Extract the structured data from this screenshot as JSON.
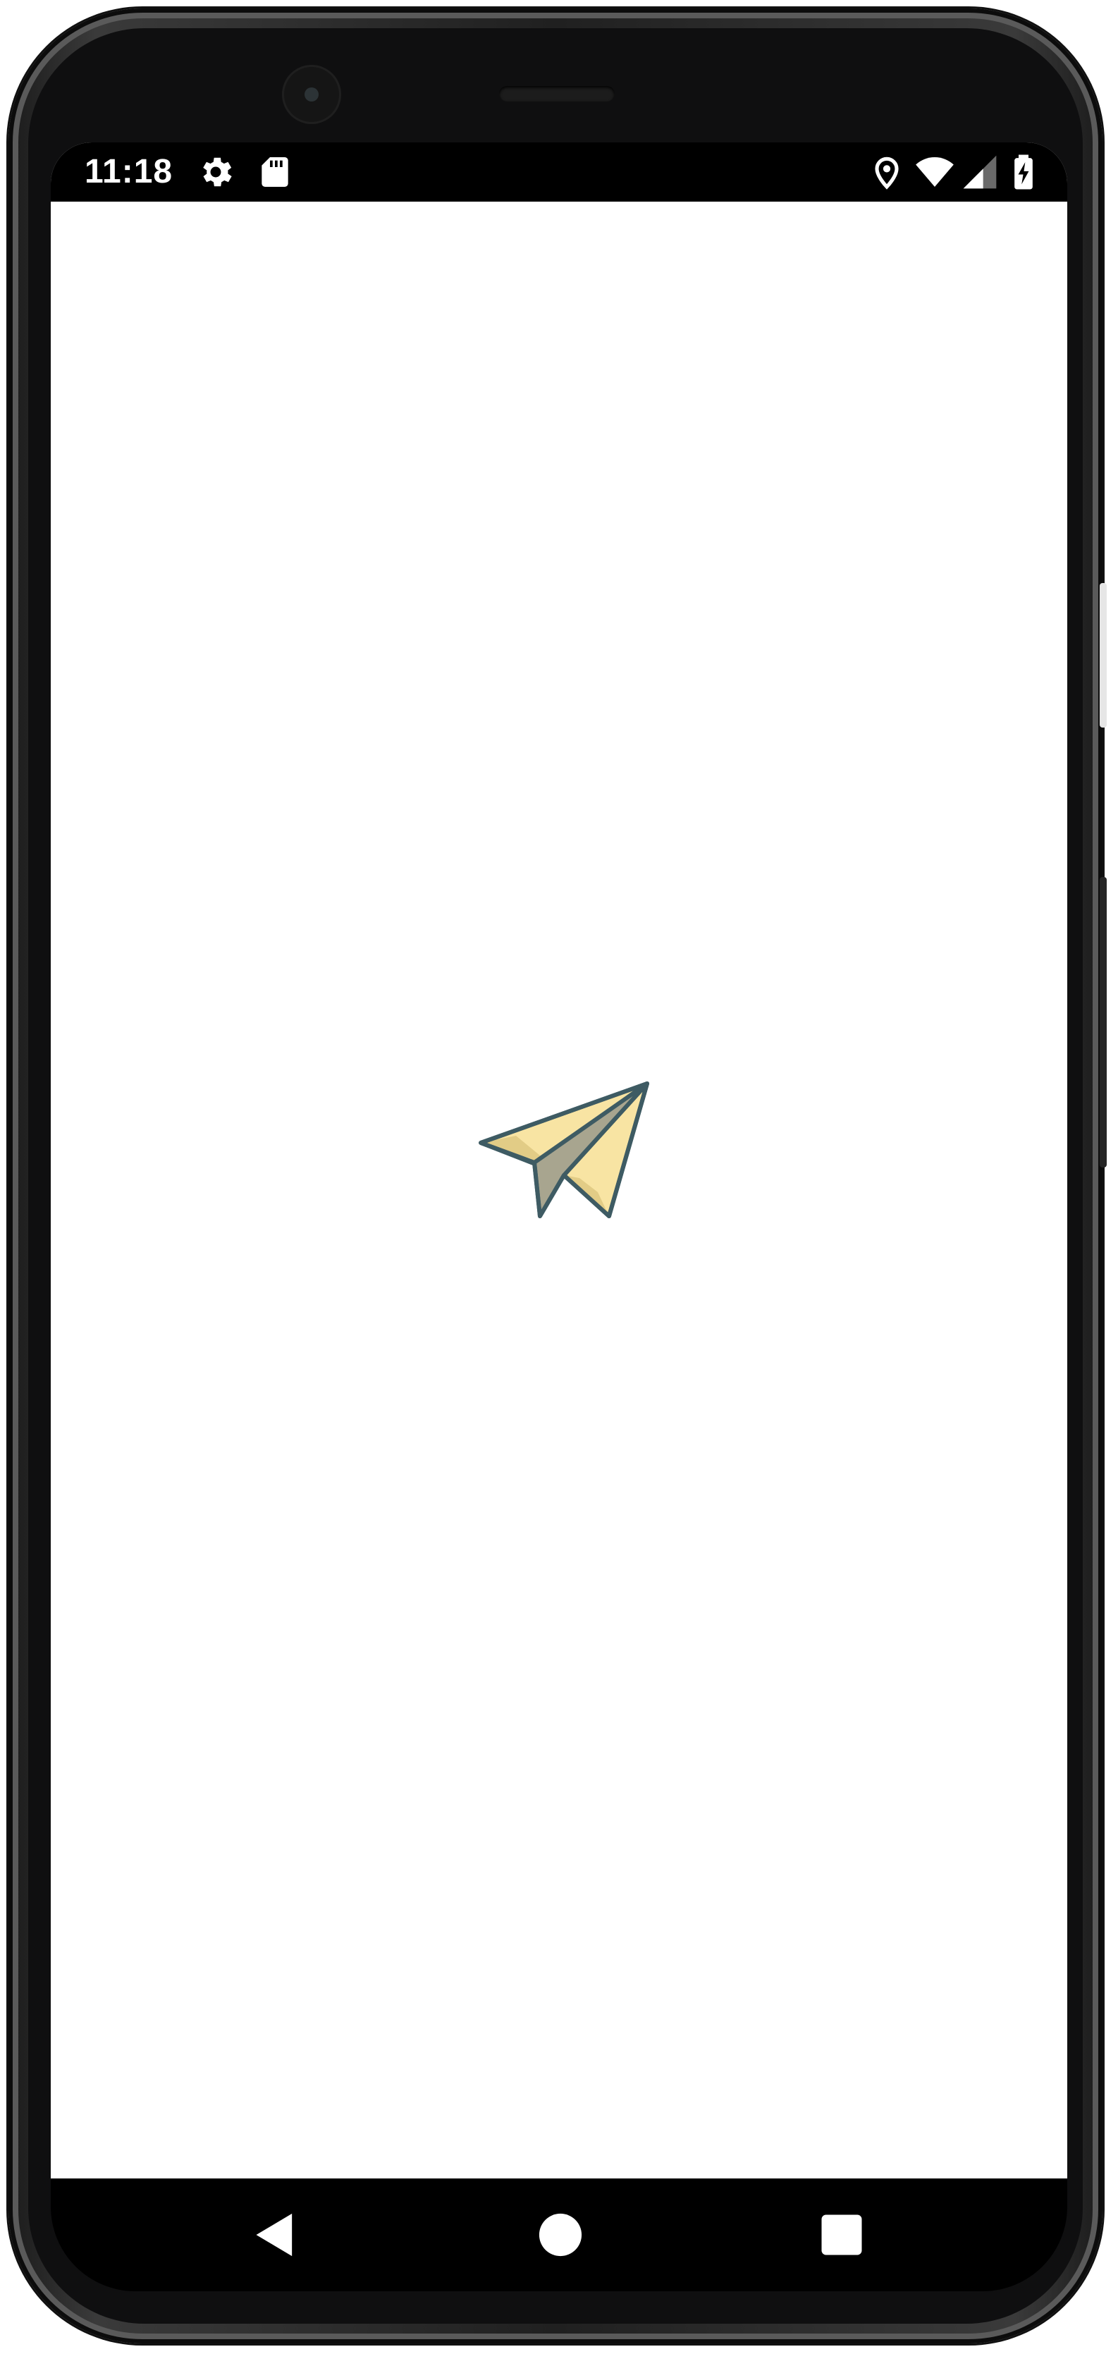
{
  "status_bar": {
    "time": "11:18",
    "left_icons": [
      "settings-gear-icon",
      "sd-card-icon"
    ],
    "right_icons": [
      "location-pin-icon",
      "wifi-icon",
      "cell-signal-icon",
      "battery-charging-icon"
    ]
  },
  "app": {
    "logo_icon": "paper-plane-icon",
    "logo_colors": {
      "fill_light": "#f8e4a3",
      "fill_shade": "#e2cc86",
      "fill_fold": "#a8a58f",
      "outline": "#3e5b63"
    }
  },
  "navigation": {
    "buttons": [
      "back-icon",
      "home-icon",
      "recents-icon"
    ]
  },
  "colors": {
    "screen_background": "#ffffff",
    "bars": "#000000",
    "frame": "#1f1f1f"
  }
}
